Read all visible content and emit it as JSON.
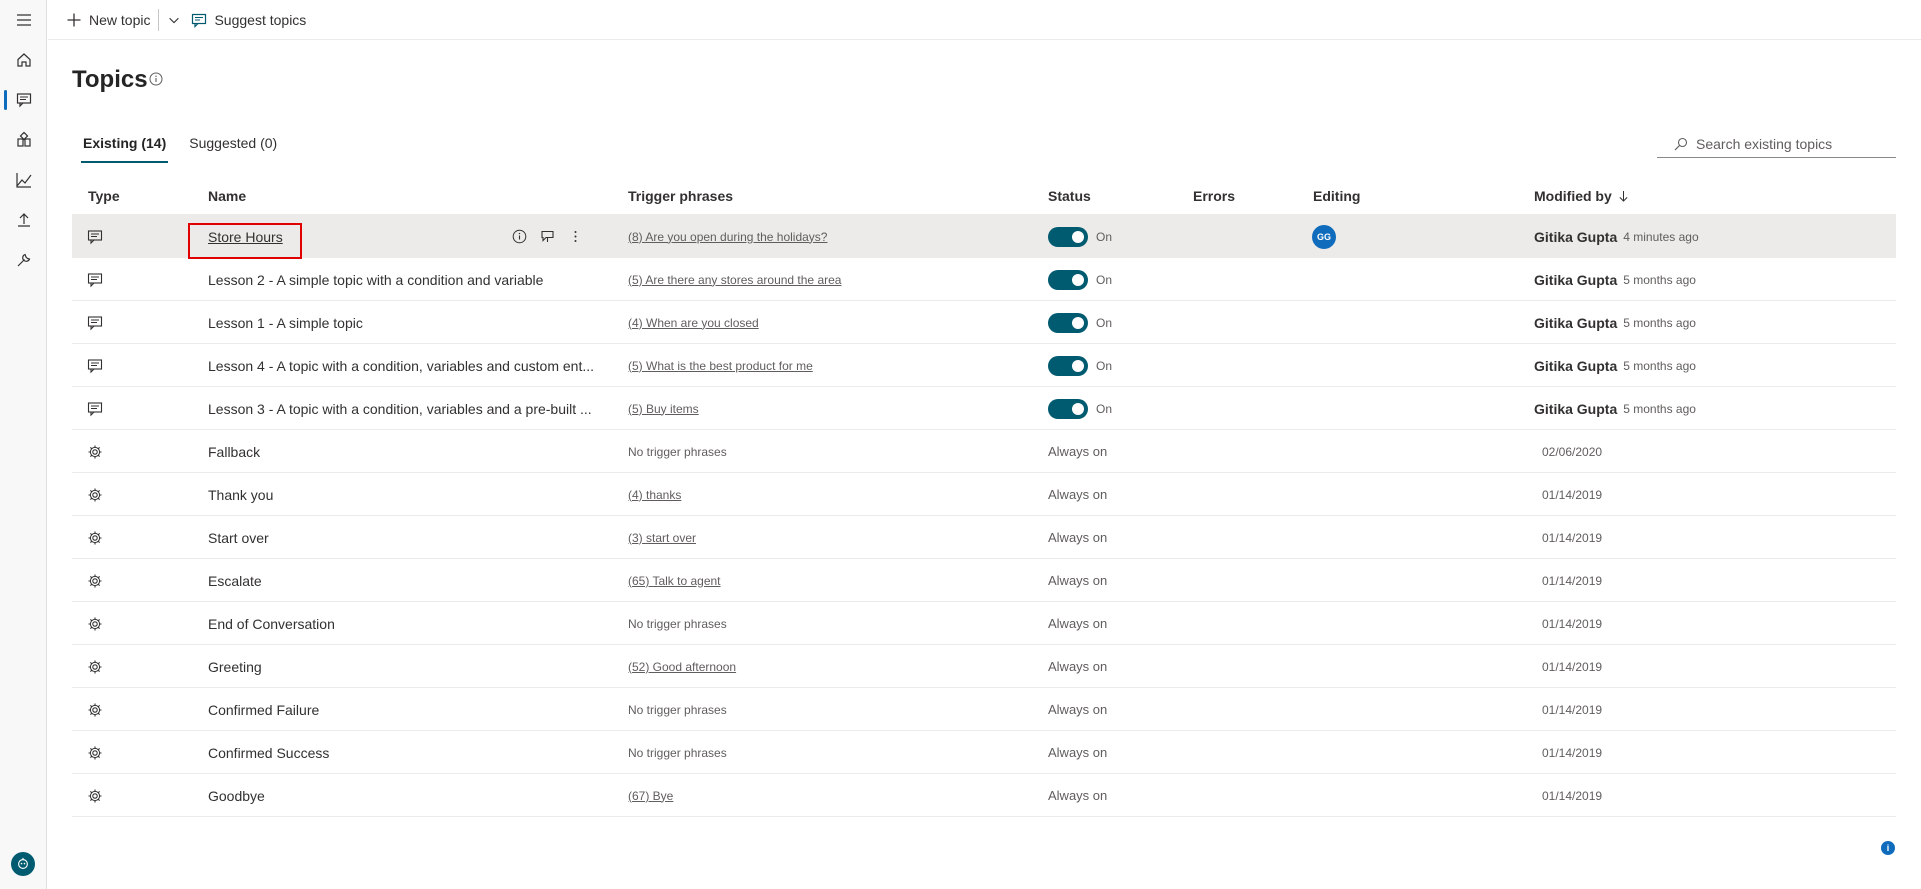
{
  "command_bar": {
    "new_topic_label": "New topic",
    "suggest_topics_label": "Suggest topics"
  },
  "page": {
    "title": "Topics"
  },
  "tabs": [
    {
      "label": "Existing (14)",
      "active": true
    },
    {
      "label": "Suggested (0)",
      "active": false
    }
  ],
  "search": {
    "placeholder": "Search existing topics"
  },
  "table": {
    "columns": {
      "type": "Type",
      "name": "Name",
      "trigger": "Trigger phrases",
      "status": "Status",
      "errors": "Errors",
      "editing": "Editing",
      "modified": "Modified by"
    },
    "rows": [
      {
        "icon": "chat-icon",
        "name": "Store Hours",
        "trigger": "(8) Are you open during the holidays?",
        "status": "On",
        "editing": "GG",
        "user": "Gitika Gupta",
        "time": "4 minutes ago"
      },
      {
        "icon": "chat-icon",
        "name": "Lesson 2 - A simple topic with a condition and variable",
        "trigger": "(5) Are there any stores around the area",
        "status": "On",
        "user": "Gitika Gupta",
        "time": "5 months ago"
      },
      {
        "icon": "chat-icon",
        "name": "Lesson 1 - A simple topic",
        "trigger": "(4) When are you closed",
        "status": "On",
        "user": "Gitika Gupta",
        "time": "5 months ago"
      },
      {
        "icon": "chat-icon",
        "name": "Lesson 4 - A topic with a condition, variables and custom ent...",
        "trigger": "(5) What is the best product for me",
        "status": "On",
        "user": "Gitika Gupta",
        "time": "5 months ago"
      },
      {
        "icon": "chat-icon",
        "name": "Lesson 3 - A topic with a condition, variables and a pre-built ...",
        "trigger": "(5) Buy items",
        "status": "On",
        "user": "Gitika Gupta",
        "time": "5 months ago"
      },
      {
        "icon": "system-gear-icon",
        "name": "Fallback",
        "trigger": "No trigger phrases",
        "status": "Always on",
        "date": "02/06/2020"
      },
      {
        "icon": "system-gear-icon",
        "name": "Thank you",
        "trigger": "(4) thanks",
        "status": "Always on",
        "date": "01/14/2019"
      },
      {
        "icon": "system-gear-icon",
        "name": "Start over",
        "trigger": "(3) start over",
        "status": "Always on",
        "date": "01/14/2019"
      },
      {
        "icon": "system-gear-icon",
        "name": "Escalate",
        "trigger": "(65) Talk to agent",
        "status": "Always on",
        "date": "01/14/2019"
      },
      {
        "icon": "system-gear-icon",
        "name": "End of Conversation",
        "trigger": "No trigger phrases",
        "status": "Always on",
        "date": "01/14/2019"
      },
      {
        "icon": "system-gear-icon",
        "name": "Greeting",
        "trigger": "(52) Good afternoon",
        "status": "Always on",
        "date": "01/14/2019"
      },
      {
        "icon": "system-gear-icon",
        "name": "Confirmed Failure",
        "trigger": "No trigger phrases",
        "status": "Always on",
        "date": "01/14/2019"
      },
      {
        "icon": "system-gear-icon",
        "name": "Confirmed Success",
        "trigger": "No trigger phrases",
        "status": "Always on",
        "date": "01/14/2019"
      },
      {
        "icon": "system-gear-icon",
        "name": "Goodbye",
        "trigger": "(67) Bye",
        "status": "Always on",
        "date": "01/14/2019"
      }
    ]
  },
  "colors": {
    "accent": "#005b70",
    "highlight_box": "#e00000",
    "selected_row": "#edebe9"
  }
}
